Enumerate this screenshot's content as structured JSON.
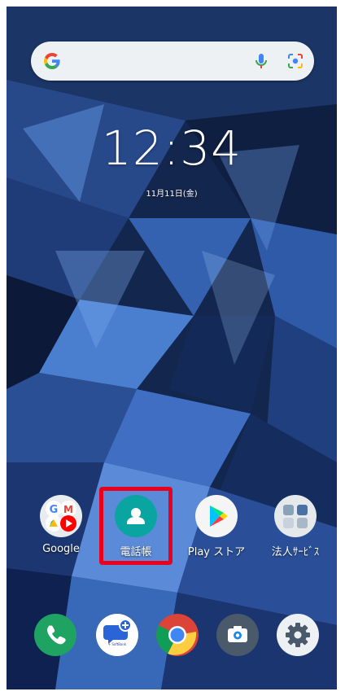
{
  "search": {
    "mic": "mic-icon",
    "lens": "lens-icon"
  },
  "lockscreen": {
    "time": "12:34",
    "date": "11月11日(金)"
  },
  "apps": [
    {
      "label": "Google"
    },
    {
      "label": "電話帳"
    },
    {
      "label": "Play ストア"
    },
    {
      "label": "法人ｻｰﾋﾞｽ"
    }
  ],
  "dock": [
    {
      "name": "phone",
      "color": "#1ea362"
    },
    {
      "name": "messages",
      "caption": "+ SoftBank",
      "color": "#ffffff"
    },
    {
      "name": "chrome",
      "color": "#db4437"
    },
    {
      "name": "camera",
      "color": "#4a5a6a"
    },
    {
      "name": "settings",
      "color": "#eef1f4"
    }
  ],
  "colors": {
    "highlight": "#e8001c",
    "contacts": "#0aa5a0",
    "wallpaper": "#1a3260"
  }
}
